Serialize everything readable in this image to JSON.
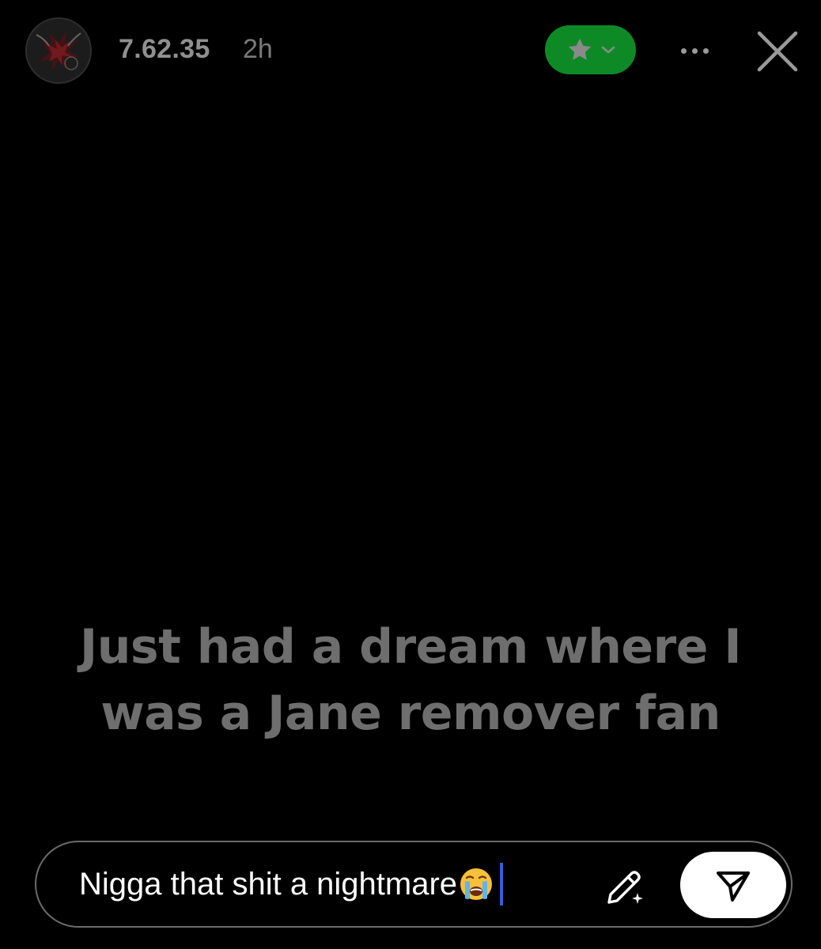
{
  "header": {
    "username": "7.62.35",
    "timestamp": "2h",
    "avatar_icon": "profile-avatar-icon",
    "close_friends_icon": "star-icon",
    "dropdown_icon": "chevron-down-icon",
    "more_icon": "more-horizontal-icon",
    "close_icon": "close-icon",
    "pill_color": "#0d8a26"
  },
  "story": {
    "line1": "Just had a dream where I",
    "line2": "was a Jane remover fan"
  },
  "reply": {
    "value": "Nigga that shit a nightmare",
    "emoji_icon": "loudly-crying-face-emoji",
    "edit_icon": "pencil-sparkle-icon",
    "send_icon": "send-icon",
    "caret_color": "#3a5bd9"
  }
}
